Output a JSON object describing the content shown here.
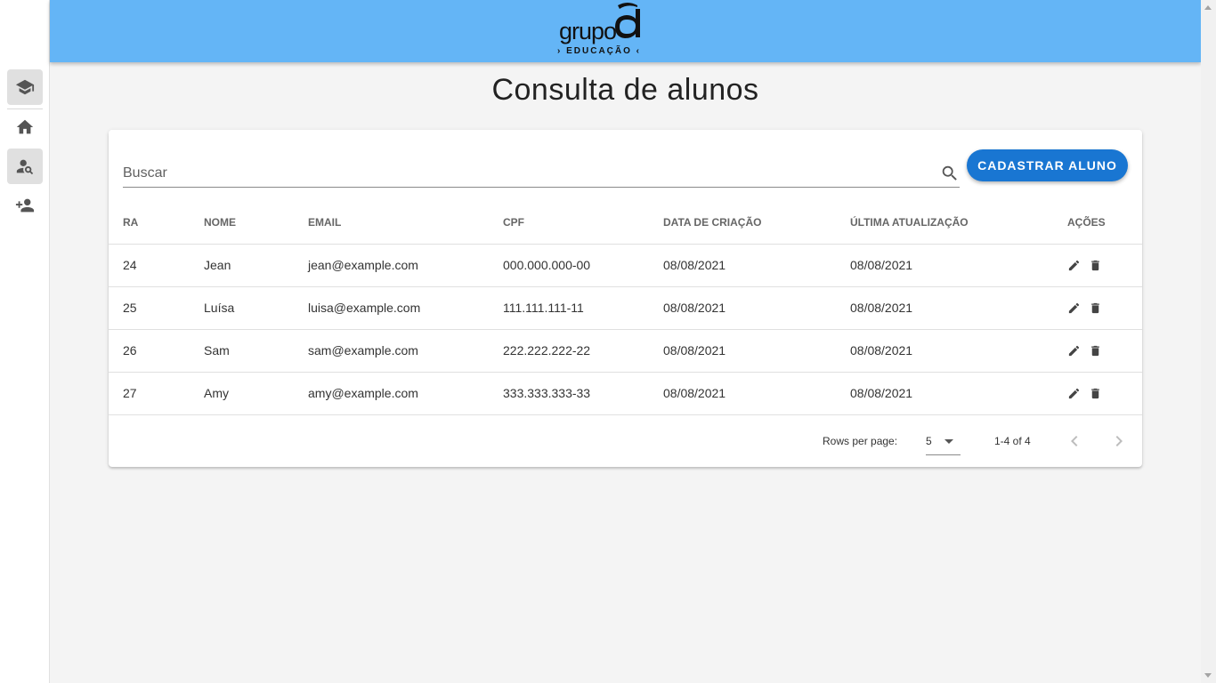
{
  "header": {
    "logo_text": "grupo",
    "logo_subtext": "› EDUCAÇÃO ‹",
    "brand_color": "#64b5f6"
  },
  "sidebar": {
    "items": [
      {
        "icon": "graduation-cap-icon",
        "active": true
      },
      {
        "icon": "home-icon",
        "active": false
      },
      {
        "icon": "person-search-icon",
        "active": true
      },
      {
        "icon": "person-add-icon",
        "active": false
      }
    ]
  },
  "page": {
    "title": "Consulta de alunos"
  },
  "search": {
    "placeholder": "Buscar",
    "value": ""
  },
  "actions": {
    "add_label": "CADASTRAR ALUNO",
    "accent_color": "#1976d2"
  },
  "table": {
    "headers": [
      "RA",
      "NOME",
      "EMAIL",
      "CPF",
      "DATA DE CRIAÇÃO",
      "ÚLTIMA ATUALIZAÇÃO",
      "AÇÕES"
    ],
    "rows": [
      {
        "ra": "24",
        "nome": "Jean",
        "email": "jean@example.com",
        "cpf": "000.000.000-00",
        "criacao": "08/08/2021",
        "atualizacao": "08/08/2021"
      },
      {
        "ra": "25",
        "nome": "Luísa",
        "email": "luisa@example.com",
        "cpf": "111.111.111-11",
        "criacao": "08/08/2021",
        "atualizacao": "08/08/2021"
      },
      {
        "ra": "26",
        "nome": "Sam",
        "email": "sam@example.com",
        "cpf": "222.222.222-22",
        "criacao": "08/08/2021",
        "atualizacao": "08/08/2021"
      },
      {
        "ra": "27",
        "nome": "Amy",
        "email": "amy@example.com",
        "cpf": "333.333.333-33",
        "criacao": "08/08/2021",
        "atualizacao": "08/08/2021"
      }
    ]
  },
  "pagination": {
    "rows_per_page_label": "Rows per page:",
    "rows_per_page_value": "5",
    "range_label": "1-4 of 4"
  }
}
